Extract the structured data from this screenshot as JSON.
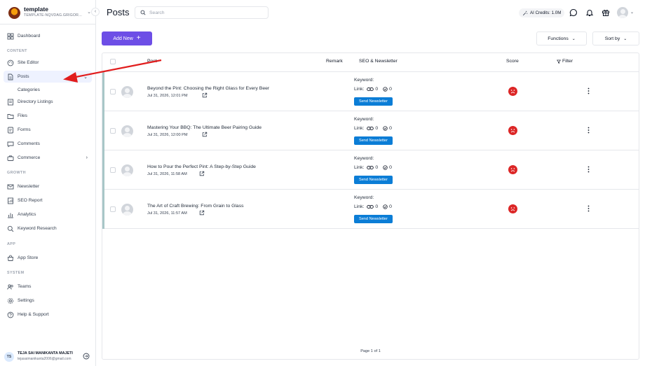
{
  "workspace": {
    "name": "template",
    "subtitle": "TEMPLATE-NQVDAG.GRIGOR..."
  },
  "sidebar": {
    "items": [
      {
        "id": "dashboard",
        "label": "Dashboard",
        "icon": "grid-icon"
      },
      {
        "id": "site-editor",
        "label": "Site Editor",
        "icon": "palette-icon"
      },
      {
        "id": "posts",
        "label": "Posts",
        "icon": "document-icon",
        "active": true,
        "expanded": true
      },
      {
        "id": "categories",
        "label": "Categories"
      },
      {
        "id": "directory-listings",
        "label": "Directory Listings",
        "icon": "list-icon"
      },
      {
        "id": "files",
        "label": "Files",
        "icon": "folder-icon"
      },
      {
        "id": "forms",
        "label": "Forms",
        "icon": "form-icon"
      },
      {
        "id": "comments",
        "label": "Comments",
        "icon": "comment-icon"
      },
      {
        "id": "commerce",
        "label": "Commerce",
        "icon": "briefcase-icon"
      },
      {
        "id": "newsletter",
        "label": "Newsletter",
        "icon": "mail-icon"
      },
      {
        "id": "seo-report",
        "label": "SEO Report",
        "icon": "report-icon"
      },
      {
        "id": "analytics",
        "label": "Analytics",
        "icon": "chart-icon"
      },
      {
        "id": "keyword-research",
        "label": "Keyword Research",
        "icon": "search-icon"
      },
      {
        "id": "app-store",
        "label": "App Store",
        "icon": "store-icon"
      },
      {
        "id": "teams",
        "label": "Teams",
        "icon": "users-icon"
      },
      {
        "id": "settings",
        "label": "Settings",
        "icon": "gear-icon"
      },
      {
        "id": "help-support",
        "label": "Help & Support",
        "icon": "help-icon"
      }
    ],
    "sections": {
      "content": "CONTENT",
      "growth": "GROWTH",
      "app": "APP",
      "system": "SYSTEM"
    },
    "user": {
      "initials": "TS",
      "name": "TEJA SAI MANIKANTA MAJETI",
      "email": "tejasaimanikanta2006@gmail.com"
    }
  },
  "header": {
    "title": "Posts",
    "search_placeholder": "Search",
    "credits": "AI Credits: 1.0M"
  },
  "toolbar": {
    "add_new": "Add New",
    "functions": "Functions",
    "sort_by": "Sort by"
  },
  "table": {
    "columns": {
      "post": "Post",
      "remark": "Remark",
      "seo": "SEO & Newsletter",
      "score": "Score",
      "filter": "Filter"
    },
    "keyword_label": "Keyword:",
    "link_label": "Link:",
    "newsletter_button": "Send Newsletter",
    "rows": [
      {
        "title": "Beyond the Pint: Choosing the Right Glass for Every Beer",
        "date": "Jul 31, 2026, 12:01 PM",
        "links": "0",
        "checks": "0"
      },
      {
        "title": "Mastering Your BBQ: The Ultimate Beer Pairing Guide",
        "date": "Jul 31, 2026, 12:00 PM",
        "links": "0",
        "checks": "0"
      },
      {
        "title": "How to Pour the Perfect Pint: A Step-by-Step Guide",
        "date": "Jul 31, 2026, 11:58 AM",
        "links": "0",
        "checks": "0"
      },
      {
        "title": "The Art of Craft Brewing: From Grain to Glass",
        "date": "Jul 31, 2026, 11:57 AM",
        "links": "0",
        "checks": "0"
      }
    ],
    "pagination": "Page 1 of 1"
  },
  "colors": {
    "accent": "#6d4ee6",
    "newsletter": "#0b7dd6",
    "score_bad": "#dc2626",
    "annotation_arrow": "#e11d1d"
  }
}
